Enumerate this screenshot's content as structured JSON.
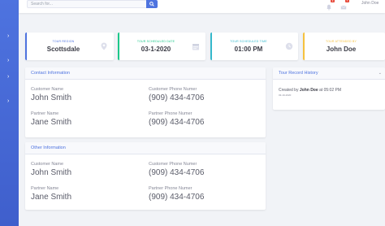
{
  "search": {
    "placeholder": "Search for..."
  },
  "header": {
    "user_name": "John Doe",
    "alerts_count": "3",
    "messages_count": "7"
  },
  "stats": [
    {
      "label": "TOUR REGION",
      "value": "Scottsdale",
      "color": "#4e73df",
      "icon": "map-marker-icon"
    },
    {
      "label": "TOUR SCHEDULED DATE",
      "value": "03-1-2020",
      "color": "#1cc88a",
      "icon": "calendar-icon"
    },
    {
      "label": "TOUR SCHEDULED TIME",
      "value": "01:00 PM",
      "color": "#36b9cc",
      "icon": "clock-icon"
    },
    {
      "label": "TOUR ATTENDED BY",
      "value": "John Doe",
      "color": "#f6c23e",
      "icon": "user-icon"
    }
  ],
  "contact": {
    "title": "Contact Information",
    "customer_name_label": "Customer Name",
    "customer_name": "John Smith",
    "customer_phone_label": "Customer Phone Numer",
    "customer_phone": "(909) 434-4706",
    "partner_name_label": "Partner Name",
    "partner_name": "Jane Smith",
    "partner_phone_label": "Partner Phone Numer",
    "partner_phone": "(909) 434-4706"
  },
  "other": {
    "title": "Other Information",
    "customer_name_label": "Customer Name",
    "customer_name": "John Smith",
    "customer_phone_label": "Customer Phone Numer",
    "customer_phone": "(909) 434-4706",
    "partner_name_label": "Partner Name",
    "partner_name": "Jane Smith",
    "partner_phone_label": "Partner Phone Numer",
    "partner_phone": "(909) 434-4706"
  },
  "history": {
    "title": "Tour Record History",
    "created_prefix": "Created by",
    "created_by": "John Doe",
    "created_suffix": "at 05:02 PM",
    "date": "03-19-2020"
  }
}
